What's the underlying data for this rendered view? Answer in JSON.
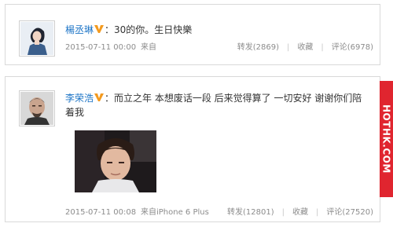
{
  "posts": [
    {
      "user": "楊丞琳",
      "text": "：30的你。生日快樂",
      "time": "2015-07-11 00:00",
      "source": "来自",
      "repost": "转发(2869)",
      "favorite": "收藏",
      "comment": "评论(6978)"
    },
    {
      "user": "李荣浩",
      "text": "：而立之年 本想废话一段 后来觉得算了 一切安好 谢谢你们陪着我",
      "time": "2015-07-11 00:08",
      "source": "来自iPhone 6 Plus",
      "repost": "转发(12801)",
      "favorite": "收藏",
      "comment": "评论(27520)"
    }
  ],
  "watermark": "HOTHK.COM",
  "colors": {
    "link": "#1a73c6",
    "vip": "#f39a1f",
    "watermark_bg": "#e0252f",
    "meta": "#8c8c8c"
  }
}
